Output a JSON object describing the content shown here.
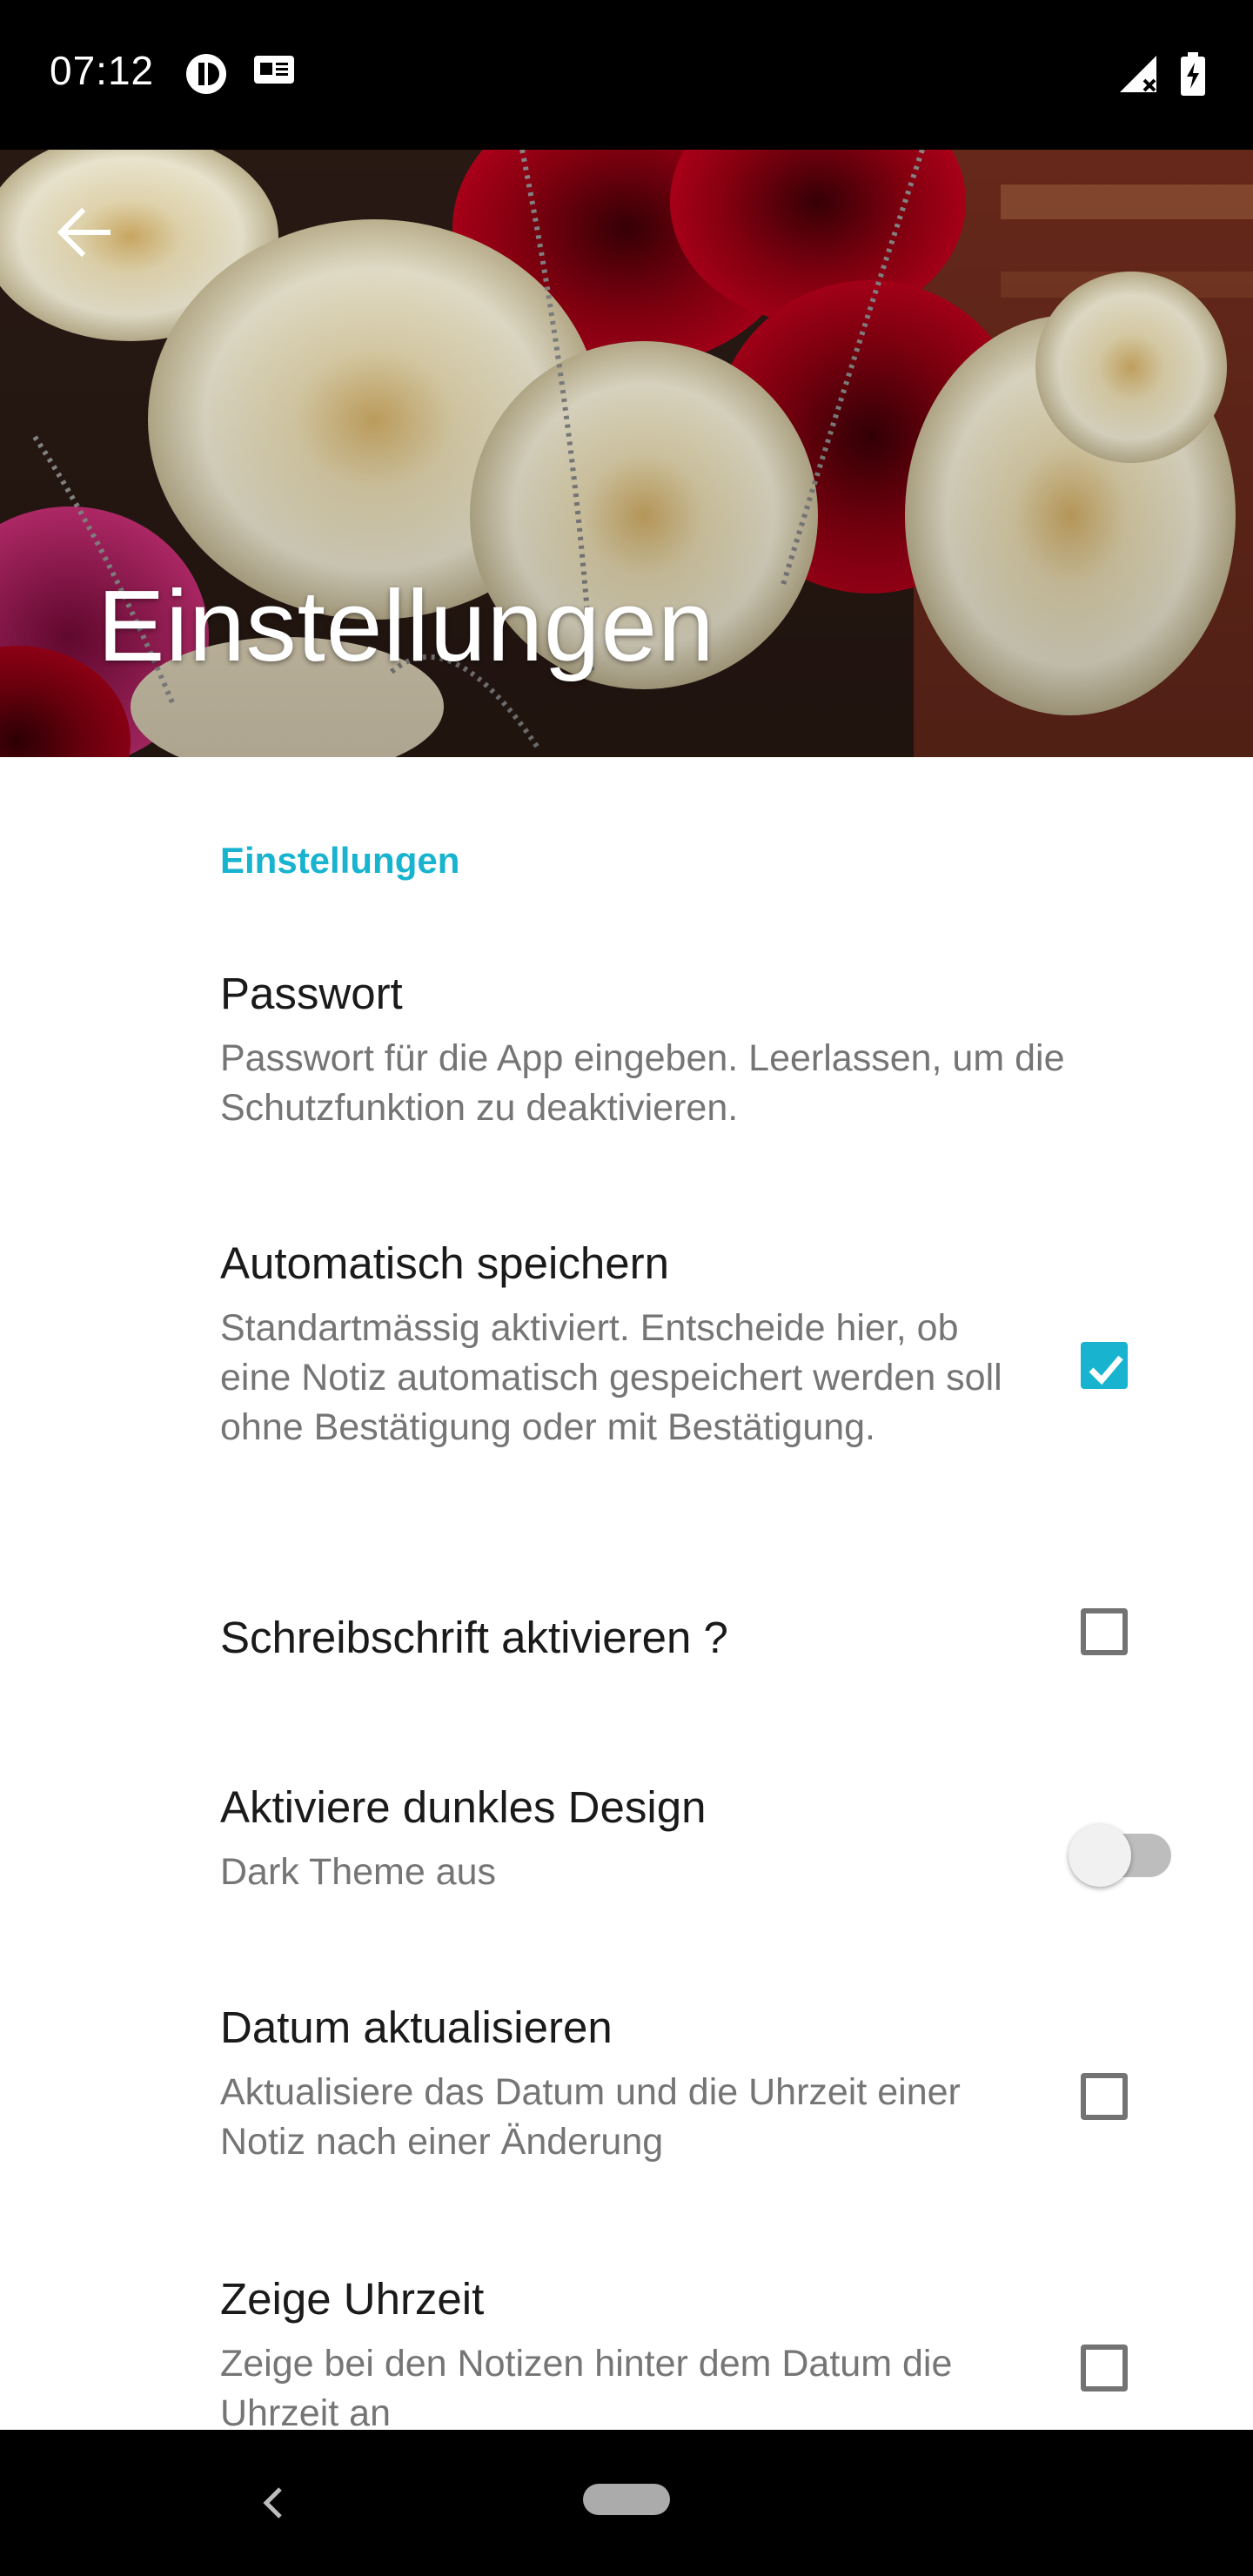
{
  "status_bar": {
    "time": "07:12",
    "icons": [
      "app-notification-icon",
      "sim-card-icon",
      "signal-icon",
      "battery-charging-icon"
    ]
  },
  "header": {
    "title": "Einstellungen",
    "back_icon": "arrow-back-icon",
    "background": "roses-photo"
  },
  "category": "Einstellungen",
  "preferences": [
    {
      "title": "Passwort",
      "summary": "Passwort für die App eingeben. Leerlassen, um die Schutzfunktion zu deaktivieren."
    },
    {
      "title": "Automatisch speichern",
      "summary": "Standartmässig aktiviert. Entscheide hier, ob eine Notiz automatisch gespeichert werden soll ohne Bestätigung oder mit Bestätigung.",
      "checked": true
    },
    {
      "title": "Schreibschrift aktivieren ?",
      "checked": false
    },
    {
      "title": "Aktiviere dunkles Design",
      "summary": "Dark Theme aus",
      "switch_on": false
    },
    {
      "title": "Datum aktualisieren",
      "summary": "Aktualisiere das Datum und die Uhrzeit einer Notiz nach einer Änderung",
      "checked": false
    },
    {
      "title": "Zeige Uhrzeit",
      "summary": "Zeige bei den Notizen hinter dem Datum die Uhrzeit an",
      "checked": false
    }
  ],
  "colors": {
    "accent": "#17b3cf",
    "title_text": "#1a1a1a",
    "summary_text": "#757575"
  },
  "nav_bar": {
    "back_icon": "nav-back-icon",
    "home_icon": "home-pill-icon"
  }
}
